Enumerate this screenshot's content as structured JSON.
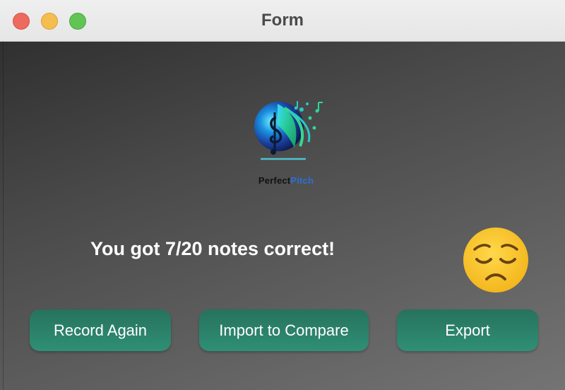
{
  "window": {
    "title": "Form",
    "traffic_lights": {
      "close": "#ee6a5e",
      "minimize": "#f5bd4f",
      "maximize": "#61c454"
    }
  },
  "logo": {
    "text_part1": "Perfect",
    "text_part2": "Pitch",
    "icon": "music-note-globe-logo"
  },
  "result": {
    "text": "You got 7/20 notes correct!",
    "emoji_icon": "pensive-face-icon"
  },
  "buttons": {
    "record_again": "Record Again",
    "import_compare": "Import to Compare",
    "export": "Export"
  },
  "colors": {
    "button_bg": "#2b8068",
    "text": "#ffffff"
  }
}
